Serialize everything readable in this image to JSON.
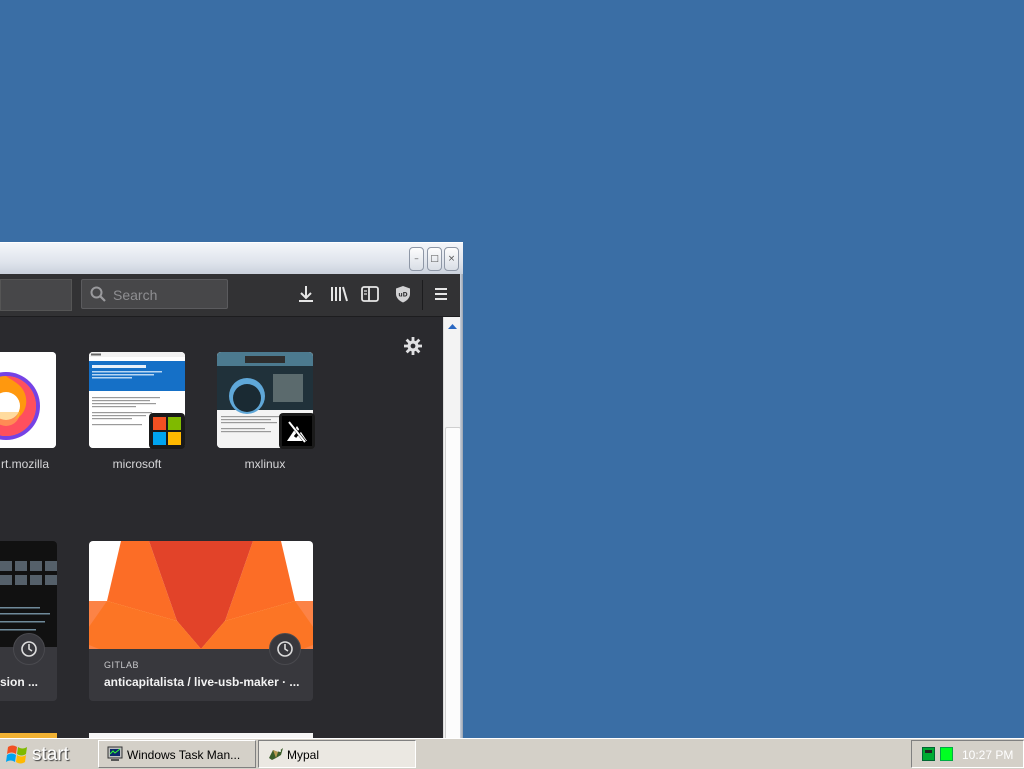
{
  "window": {
    "minimize_glyph": "–",
    "maximize_glyph": "□",
    "close_glyph": "×"
  },
  "toolbar": {
    "search_placeholder": "Search",
    "icons": [
      "download-icon",
      "library-icon",
      "sidebar-icon",
      "ublock-icon",
      "hamburger-menu-icon"
    ]
  },
  "top_sites": [
    {
      "label": "rt.mozilla",
      "icon": "firefox-logo"
    },
    {
      "label": "microsoft",
      "icon": "microsoft-logo"
    },
    {
      "label": "mxlinux",
      "icon": "mxlinux-logo"
    }
  ],
  "highlights": [
    {
      "source": "",
      "title": "sion ..."
    },
    {
      "source": "GITLAB",
      "title": "anticapitalista / live-usb-maker · ..."
    }
  ],
  "thumbnails": {
    "microsoft_heading": "Download Windows 10 Disc Image (ISO File)",
    "mx_heading": "MX Linux"
  },
  "taskbar": {
    "start_label": "start",
    "tasks": [
      {
        "label": "Windows Task Man...",
        "icon": "task-manager-icon",
        "active": false
      },
      {
        "label": "Mypal",
        "icon": "mypal-icon",
        "active": true
      }
    ],
    "clock": "10:27 PM"
  },
  "colors": {
    "desktop": "#3a6ea5",
    "browser_bg": "#2a2a2e",
    "toolbar_bg": "#323234",
    "taskbar_bg": "#d4d0c8",
    "gitlab_orange": "#fc6d26",
    "gitlab_red": "#e24329",
    "gitlab_yellow": "#fca326"
  }
}
